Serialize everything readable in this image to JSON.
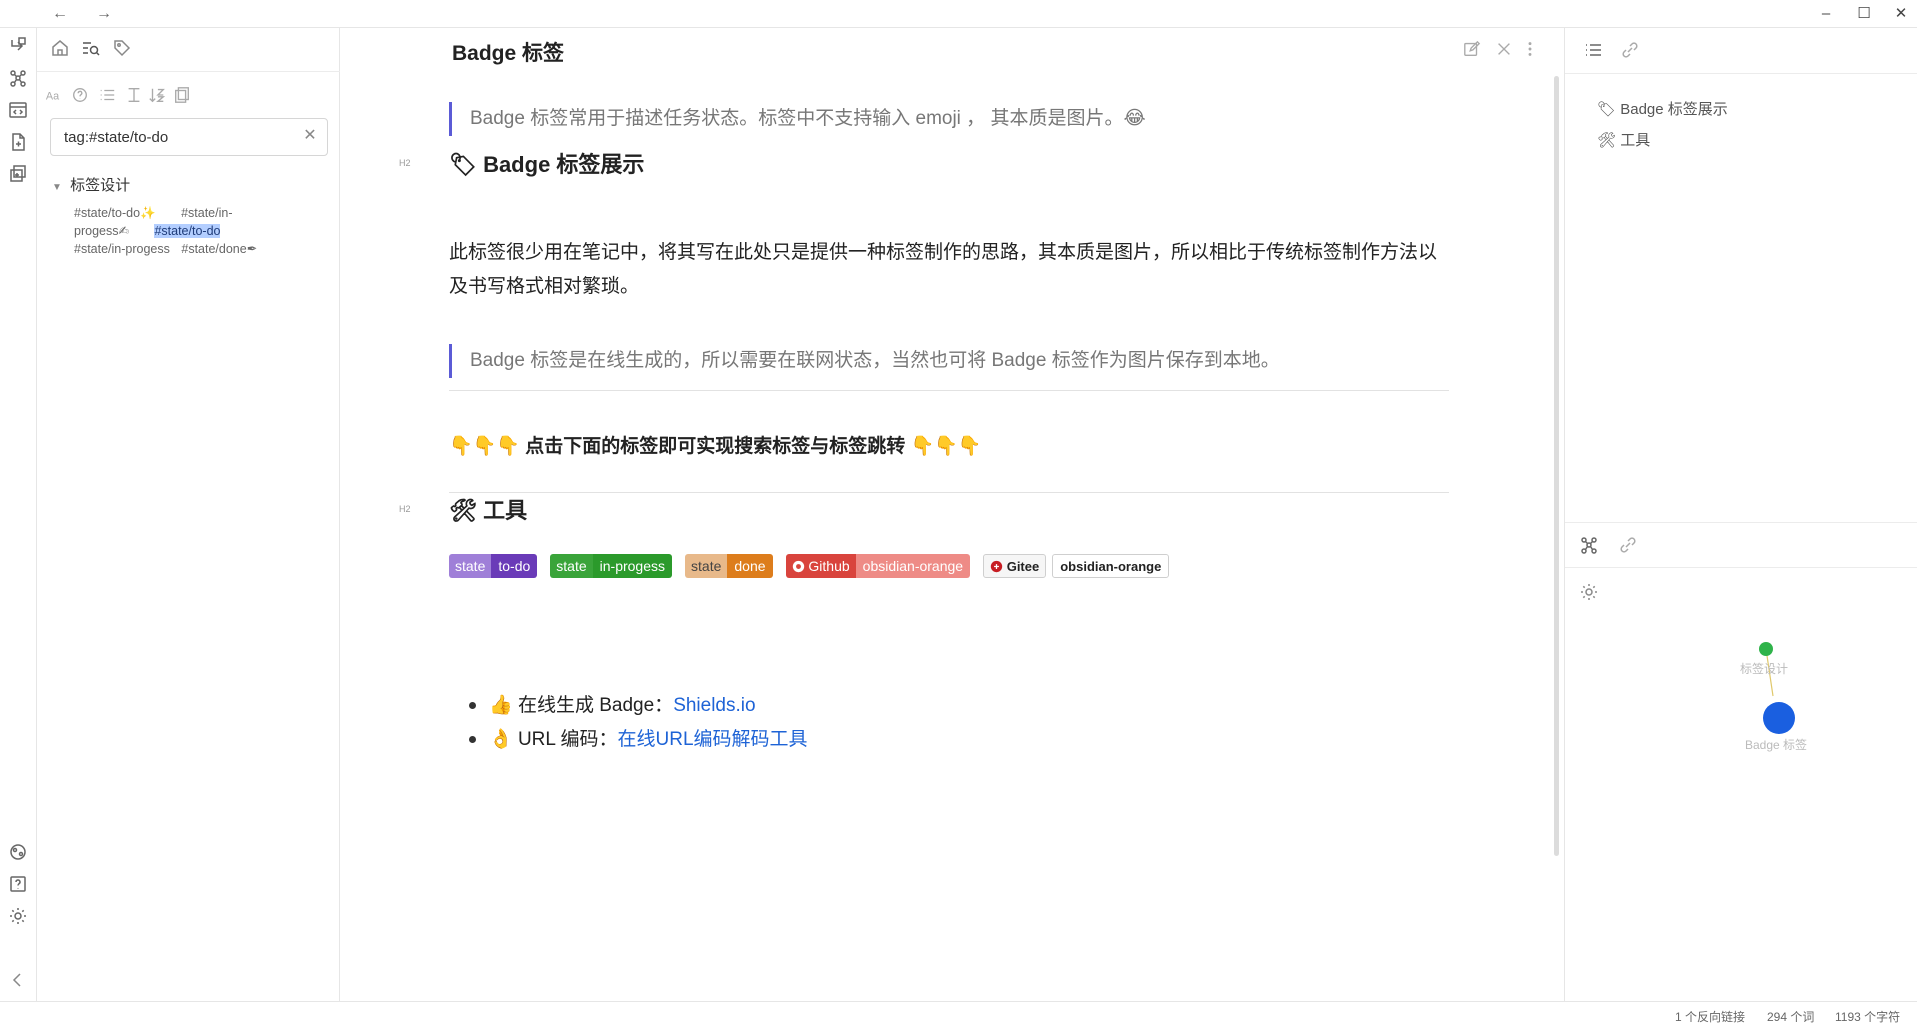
{
  "titlebar": {
    "back": "←",
    "forward": "→",
    "minimize": "–",
    "maximize": "☐",
    "close": "✕"
  },
  "left_sidebar": {
    "search": {
      "value": "tag:#state/to-do",
      "clear": "✕"
    },
    "results": [
      {
        "folder": "标签设计",
        "chevron": "▼",
        "line1_a": "#state/to-do",
        "line1_a_emoji": "✨",
        "line1_b": "#state/in-",
        "line2_a": "progess",
        "line2_a_emoji": "✍",
        "line2_highlight": "#state/to-do",
        "line3_a": "#state/in-progess",
        "line3_b": "#state/done",
        "line3_b_emoji": "✒"
      }
    ]
  },
  "editor": {
    "title": "Badge 标签",
    "quote1": "Badge 标签常用于描述任务状态。标签中不支持输入 emoji ， 其本质是图片。😂",
    "heading1": {
      "tag": "H2",
      "icon": "🏷",
      "text": "Badge 标签展示"
    },
    "paragraph": "此标签很少用在笔记中，将其写在此处只是提供一种标签制作的思路，其本质是图片，所以相比于传统标签制作方法以及书写格式相对繁琐。",
    "quote2": "Badge 标签是在线生成的，所以需要在联网状态，当然也可将 Badge 标签作为图片保存到本地。",
    "heading3": {
      "emoji_left": "👇👇👇",
      "text": "点击下面的标签即可实现搜索标签与标签跳转",
      "emoji_right": "👇👇👇"
    },
    "badges": [
      {
        "left": "state",
        "right": "to-do",
        "left_color": "#9f7fd8",
        "right_color": "#6a3bb8"
      },
      {
        "left": "state",
        "right": "in-progess",
        "left_color": "#3aa43a",
        "right_color": "#2b9a2b"
      },
      {
        "left": "state",
        "right": "done",
        "left_color": "#e8b98a",
        "right_color": "#dd7d1c"
      },
      {
        "left": "Github",
        "right": "obsidian-orange",
        "left_color": "#d9443d",
        "right_color": "#ee8b86"
      },
      {
        "left": "Gitee",
        "right": "obsidian-orange"
      }
    ],
    "heading2": {
      "tag": "H2",
      "icon": "🛠",
      "text": "工具"
    },
    "list": [
      {
        "emoji": "👍",
        "text": "在线生成 Badge：",
        "link": "Shields.io"
      },
      {
        "emoji": "👌",
        "text": "URL 编码：",
        "link": "在线URL编码解码工具"
      }
    ]
  },
  "right_sidebar": {
    "outline": [
      {
        "icon": "🏷",
        "label": "Badge 标签展示"
      },
      {
        "icon": "🛠",
        "label": "工具"
      }
    ],
    "graph": {
      "nodes": [
        {
          "label": "标签设计",
          "color": "#2fb34a"
        },
        {
          "label": "Badge 标签",
          "color": "#1a5fe0"
        }
      ],
      "edge_color": "#e0c86b"
    }
  },
  "statusbar": {
    "backlinks": "1 个反向链接",
    "words": "294 个词",
    "chars": "1193 个字符"
  }
}
